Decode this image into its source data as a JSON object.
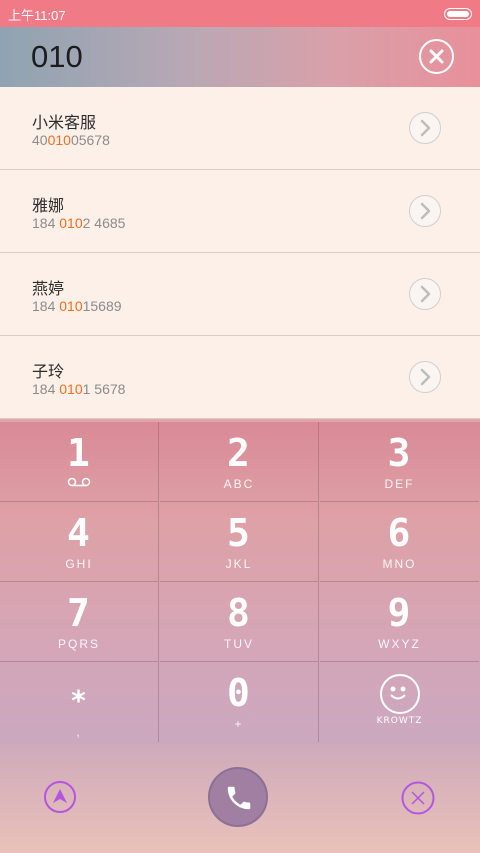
{
  "status": {
    "time": "上午11:07"
  },
  "dialer": {
    "number": "010"
  },
  "results": [
    {
      "name": "小米客服",
      "num_pre": "40",
      "num_match": "010",
      "num_post": "05678"
    },
    {
      "name": "雅娜",
      "num_pre": "184 ",
      "num_match": "010",
      "num_post": "2 4685"
    },
    {
      "name": "燕婷",
      "num_pre": "184 ",
      "num_match": "010",
      "num_post": "15689"
    },
    {
      "name": "子玲",
      "num_pre": "184 ",
      "num_match": "010",
      "num_post": "1 5678"
    }
  ],
  "keys": [
    {
      "digit": "1",
      "letters": ""
    },
    {
      "digit": "2",
      "letters": "ABC"
    },
    {
      "digit": "3",
      "letters": "DEF"
    },
    {
      "digit": "4",
      "letters": "GHI"
    },
    {
      "digit": "5",
      "letters": "JKL"
    },
    {
      "digit": "6",
      "letters": "MNO"
    },
    {
      "digit": "7",
      "letters": "PQRS"
    },
    {
      "digit": "8",
      "letters": "TUV"
    },
    {
      "digit": "9",
      "letters": "WXYZ"
    },
    {
      "digit": "*",
      "letters": ","
    },
    {
      "digit": "0",
      "letters": "+"
    },
    {
      "digit": "",
      "letters": "KROWTZ"
    }
  ],
  "colors": {
    "highlight": "#f06e1f",
    "call": "#a17fa3",
    "accent": "#b455e0"
  },
  "icons": {
    "clear": "close-circle-icon",
    "voicemail": "voicemail-icon",
    "call": "phone-icon",
    "collapse": "up-arrow-icon",
    "hangup": "close-icon"
  }
}
